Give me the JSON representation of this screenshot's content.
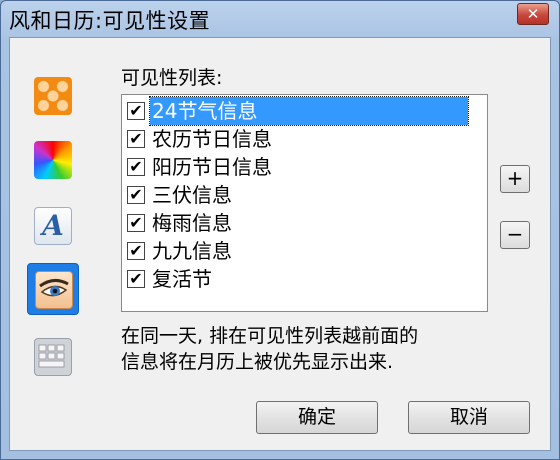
{
  "window": {
    "title": "风和日历:可见性设置",
    "close_glyph": "✕"
  },
  "sidebar": {
    "items": [
      {
        "icon": "grid-icon",
        "active": false
      },
      {
        "icon": "color-wheel-icon",
        "active": false
      },
      {
        "icon": "font-icon",
        "active": false,
        "glyph": "A"
      },
      {
        "icon": "eye-icon",
        "active": true
      },
      {
        "icon": "keyboard-icon",
        "active": false
      }
    ]
  },
  "visibility": {
    "list_label": "可见性列表:",
    "items": [
      {
        "label": "24节气信息",
        "checked": true,
        "selected": true
      },
      {
        "label": "农历节日信息",
        "checked": true,
        "selected": false
      },
      {
        "label": "阳历节日信息",
        "checked": true,
        "selected": false
      },
      {
        "label": "三伏信息",
        "checked": true,
        "selected": false
      },
      {
        "label": "梅雨信息",
        "checked": true,
        "selected": false
      },
      {
        "label": "九九信息",
        "checked": true,
        "selected": false
      },
      {
        "label": "复活节",
        "checked": true,
        "selected": false
      }
    ],
    "check_glyph": "✔",
    "add_label": "+",
    "remove_label": "−"
  },
  "note": {
    "line1": "在同一天, 排在可见性列表越前面的",
    "line2": "信息将在月历上被优先显示出来."
  },
  "buttons": {
    "ok_label": "确定",
    "cancel_label": "取消"
  },
  "colors": {
    "selection": "#3399ff",
    "active_sidebar": "#1f7ee6",
    "titlebar": "#a9c3e3"
  }
}
